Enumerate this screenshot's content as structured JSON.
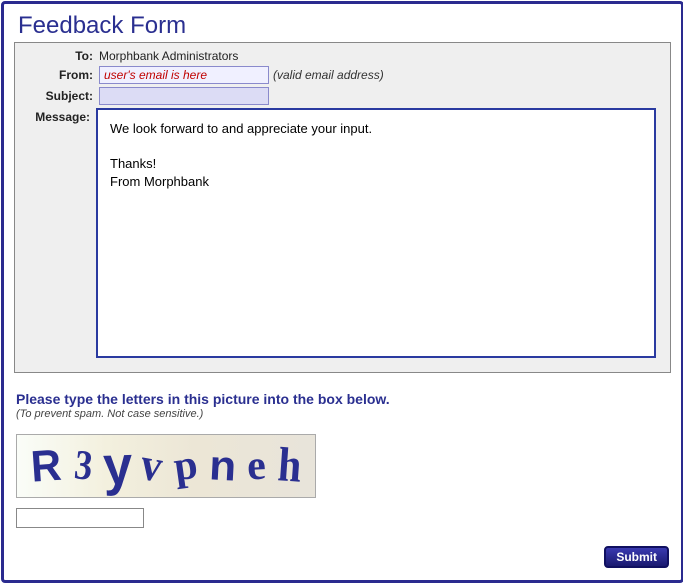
{
  "title": "Feedback Form",
  "labels": {
    "to": "To:",
    "from": "From:",
    "subject": "Subject:",
    "message": "Message:"
  },
  "to_value": "Morphbank Administrators",
  "from_value": "user's email is here",
  "from_hint": "(valid email address)",
  "subject_value": "",
  "message_value": "We look forward to and appreciate your input.\n\nThanks!\nFrom Morphbank",
  "captcha": {
    "instruction": "Please type the letters in this picture into the box below.",
    "sub": "(To prevent spam. Not case sensitive.)",
    "text": "R3yvpneh",
    "input_value": ""
  },
  "submit_label": "Submit"
}
